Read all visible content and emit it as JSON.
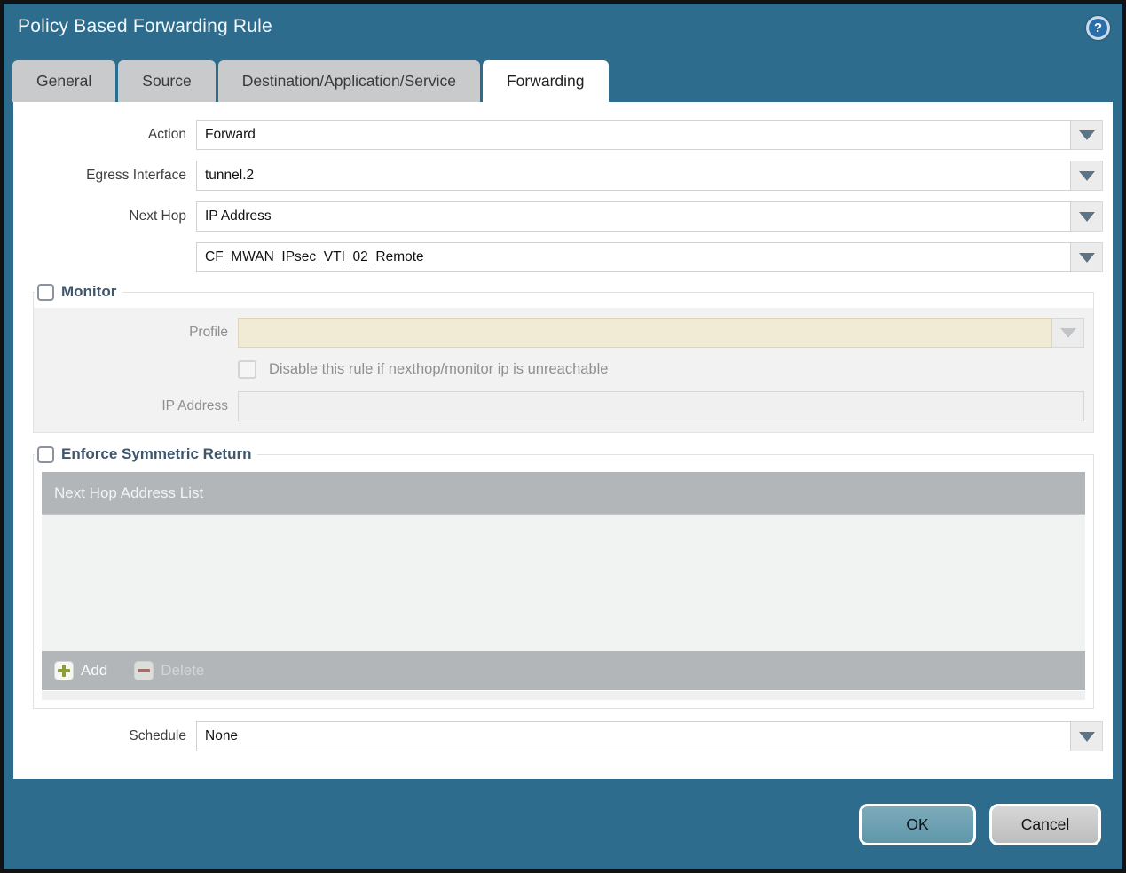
{
  "window": {
    "title": "Policy Based Forwarding Rule"
  },
  "tabs": [
    {
      "label": "General",
      "active": false
    },
    {
      "label": "Source",
      "active": false
    },
    {
      "label": "Destination/Application/Service",
      "active": false
    },
    {
      "label": "Forwarding",
      "active": true
    }
  ],
  "form": {
    "action": {
      "label": "Action",
      "value": "Forward"
    },
    "egress_interface": {
      "label": "Egress Interface",
      "value": "tunnel.2"
    },
    "next_hop": {
      "label": "Next Hop",
      "value": "IP Address"
    },
    "next_hop_address": {
      "label": "",
      "value": "CF_MWAN_IPsec_VTI_02_Remote"
    },
    "schedule": {
      "label": "Schedule",
      "value": "None"
    }
  },
  "monitor": {
    "legend": "Monitor",
    "checked": false,
    "profile_label": "Profile",
    "profile_value": "",
    "disable_rule_label": "Disable this rule if nexthop/monitor ip is unreachable",
    "ip_address_label": "IP Address",
    "ip_address_value": ""
  },
  "symmetric_return": {
    "legend": "Enforce Symmetric Return",
    "checked": false,
    "table_header": "Next Hop Address List",
    "rows": [],
    "add_label": "Add",
    "delete_label": "Delete"
  },
  "footer": {
    "ok_label": "OK",
    "cancel_label": "Cancel"
  },
  "colors": {
    "chrome_teal": "#2d6c8c",
    "tab_gray": "#c9cacb",
    "table_gray": "#b2b6b9",
    "disabled_beige": "#f1ead5",
    "ok_button": "#6aa1b2",
    "add_plus_green": "#8c9c3a",
    "delete_minus_red": "#a2635d",
    "legend_text": "#40566b"
  }
}
